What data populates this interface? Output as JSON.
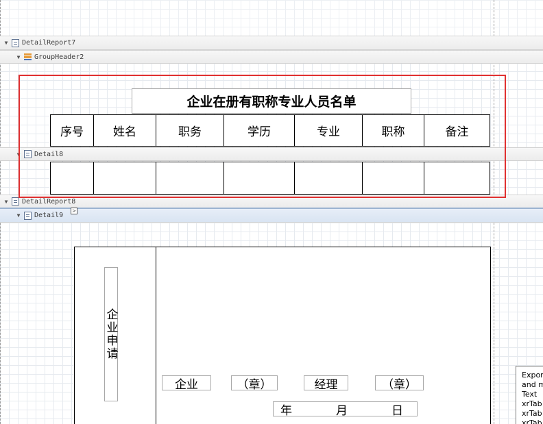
{
  "bands": {
    "detail_report7": "DetailReport7",
    "group_header2": "GroupHeader2",
    "detail8": "Detail8",
    "detail_report8": "DetailReport8",
    "detail9": "Detail9"
  },
  "roster": {
    "title": "企业在册有职称专业人员名单",
    "headers": [
      "序号",
      "姓名",
      "职务",
      "学历",
      "专业",
      "职称",
      "备注"
    ]
  },
  "application": {
    "side_label": "企业申请",
    "company_label": "企业",
    "company_seal": "（章）",
    "manager_label": "经理",
    "manager_seal": "（章）",
    "date_year": "年",
    "date_month": "月",
    "date_day": "日"
  },
  "tooltip": {
    "lines": [
      "Expor",
      "and m",
      "Text",
      "xrTab",
      "xrTab",
      "xrTab"
    ]
  },
  "colors": {
    "selection_outline": "#e03030",
    "band_selected": "#d9e4f2",
    "grid": "#e6eaef"
  }
}
